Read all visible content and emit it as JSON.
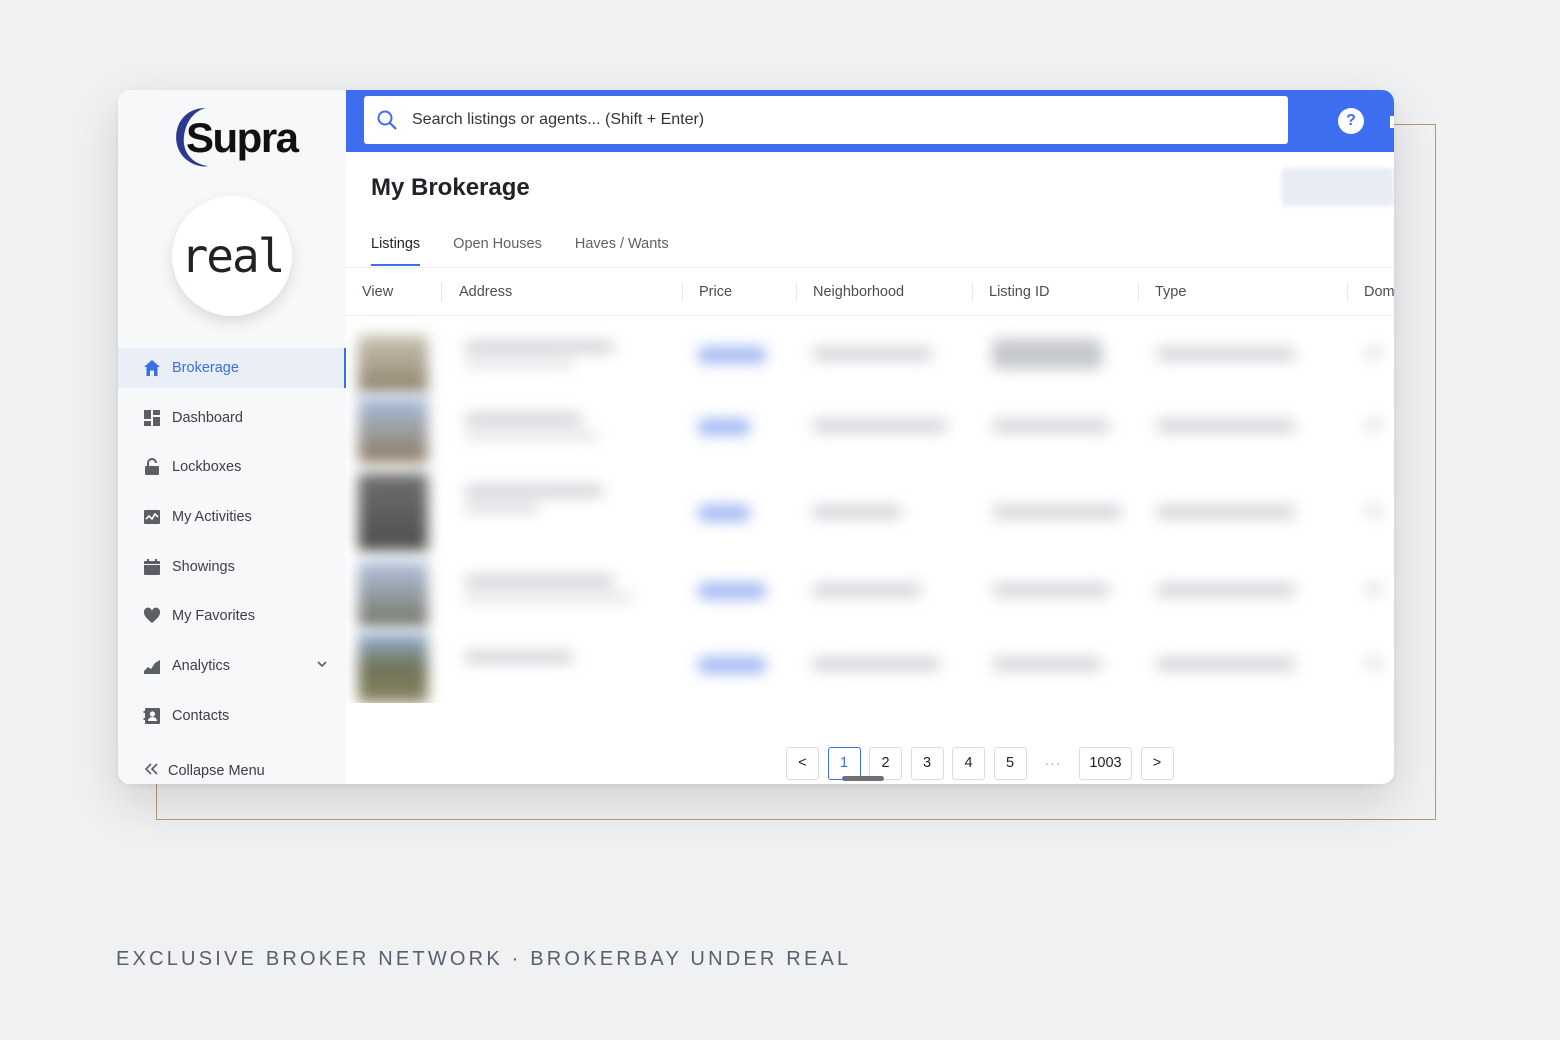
{
  "sidebar": {
    "logo_text": "Supra",
    "brand_text": "real",
    "items": [
      {
        "label": "Brokerage",
        "icon": "home-icon",
        "active": true
      },
      {
        "label": "Dashboard",
        "icon": "dashboard-icon"
      },
      {
        "label": "Lockboxes",
        "icon": "lock-icon"
      },
      {
        "label": "My Activities",
        "icon": "activity-icon"
      },
      {
        "label": "Showings",
        "icon": "calendar-icon"
      },
      {
        "label": "My Favorites",
        "icon": "heart-icon"
      },
      {
        "label": "Analytics",
        "icon": "chart-icon",
        "expandable": true
      },
      {
        "label": "Contacts",
        "icon": "contacts-icon"
      }
    ],
    "collapse_label": "Collapse Menu"
  },
  "topbar": {
    "search_placeholder": "Search listings or agents... (Shift + Enter)",
    "help_label": "?"
  },
  "main": {
    "title": "My Brokerage",
    "tabs": [
      {
        "label": "Listings",
        "active": true
      },
      {
        "label": "Open Houses"
      },
      {
        "label": "Haves / Wants"
      }
    ],
    "columns": [
      "View",
      "Address",
      "Price",
      "Neighborhood",
      "Listing ID",
      "Type",
      "Dom"
    ]
  },
  "pagination": {
    "prev": "<",
    "pages": [
      "1",
      "2",
      "3",
      "4",
      "5"
    ],
    "ellipsis": "···",
    "last": "1003",
    "next": ">",
    "current": "1"
  },
  "caption": "EXCLUSIVE BROKER NETWORK · BROKERBAY UNDER REAL",
  "colors": {
    "accent": "#3d6ef0",
    "frame": "#b49a78",
    "background": "#f0f1f3"
  }
}
